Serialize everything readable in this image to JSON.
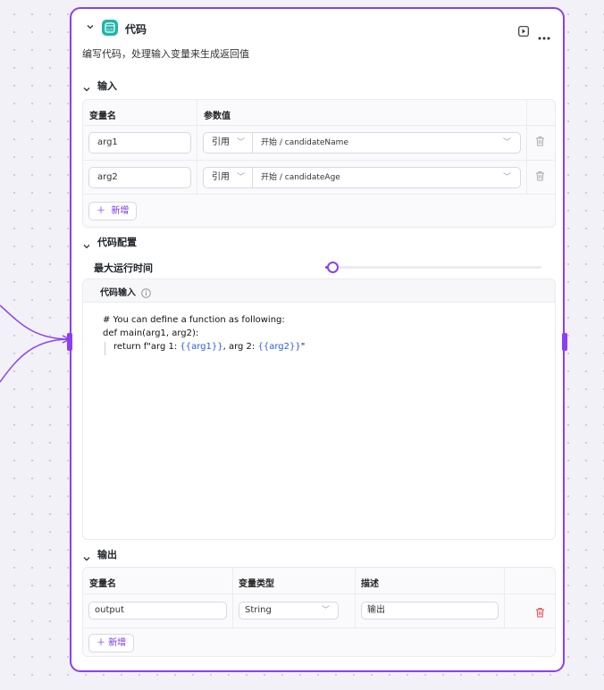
{
  "node": {
    "title": "代码",
    "description": "编写代码，处理输入变量来生成返回值",
    "accent_color": "#8a3ff5",
    "icon_color": "#1fb5a8"
  },
  "input_section": {
    "title": "输入",
    "col_name": "变量名",
    "col_value": "参数值",
    "rows": [
      {
        "name": "arg1",
        "ref_type": "引用",
        "ref_value": "开始 / candidateName"
      },
      {
        "name": "arg2",
        "ref_type": "引用",
        "ref_value": "开始 / candidateAge"
      }
    ],
    "add_label": "新增"
  },
  "code_config": {
    "title": "代码配置",
    "max_runtime_label": "最大运行时间",
    "max_runtime_level": 0.03,
    "code_input_label": "代码输入",
    "code_lines": {
      "line1": "# You can define a function as following:",
      "line2": "def main(arg1, arg2):",
      "line3_a": "return f\"arg 1: ",
      "line3_b": "{{arg1}}",
      "line3_c": ", arg 2: ",
      "line3_d": "{{arg2}}",
      "line3_e": "\""
    }
  },
  "output_section": {
    "title": "输出",
    "col_name": "变量名",
    "col_type": "变量类型",
    "col_desc": "描述",
    "rows": [
      {
        "name": "output",
        "type": "String",
        "desc": "输出"
      }
    ],
    "add_label": "新增"
  }
}
